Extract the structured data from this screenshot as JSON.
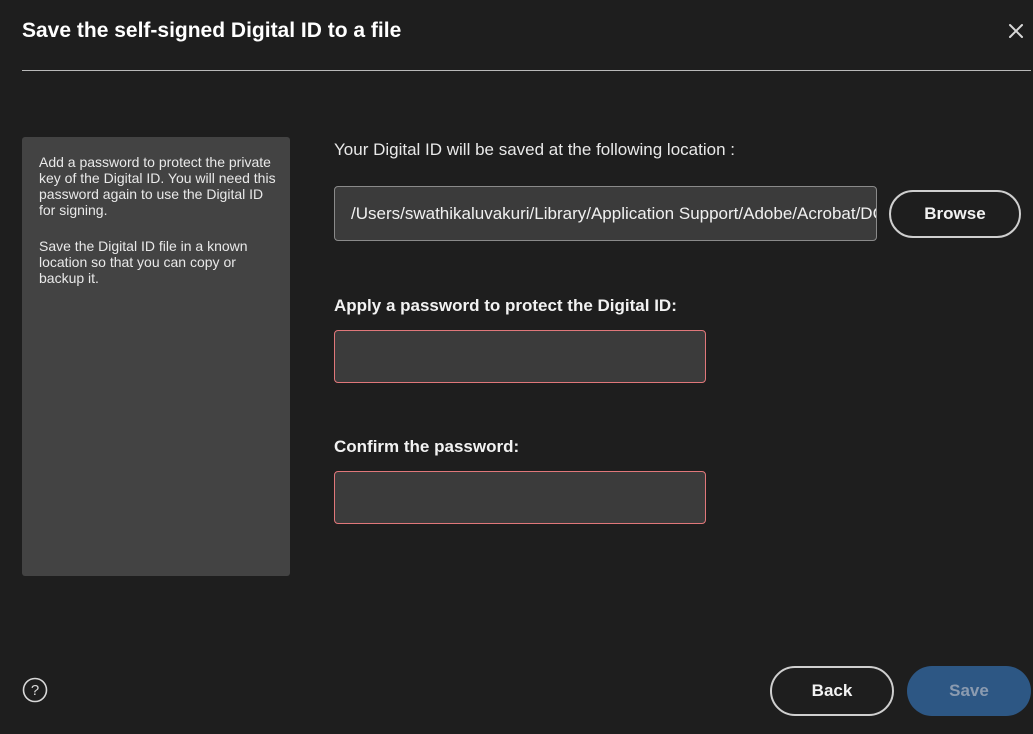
{
  "dialog": {
    "title": "Save the self-signed Digital ID to a file",
    "close_icon": "close-icon"
  },
  "help_panel": {
    "paragraph_1": "Add a password to protect the private key of the Digital ID. You will need this password again to use the Digital ID for signing.",
    "paragraph_2": "Save the Digital ID file in a known location so that you can copy or backup it."
  },
  "location": {
    "label": "Your Digital ID will be saved at the following location :",
    "path_value": "/Users/swathikaluvakuri/Library/Application Support/Adobe/Acrobat/DC/Security",
    "browse_label": "Browse"
  },
  "password": {
    "label": "Apply a password to protect the Digital ID:",
    "value": ""
  },
  "confirm": {
    "label": "Confirm the password:",
    "value": ""
  },
  "footer": {
    "help_icon": "help-circle-icon",
    "back_label": "Back",
    "save_label": "Save"
  },
  "colors": {
    "background": "#1e1e1e",
    "panel": "#434343",
    "error_border": "#e0777a",
    "primary_disabled": "#2d5784"
  }
}
